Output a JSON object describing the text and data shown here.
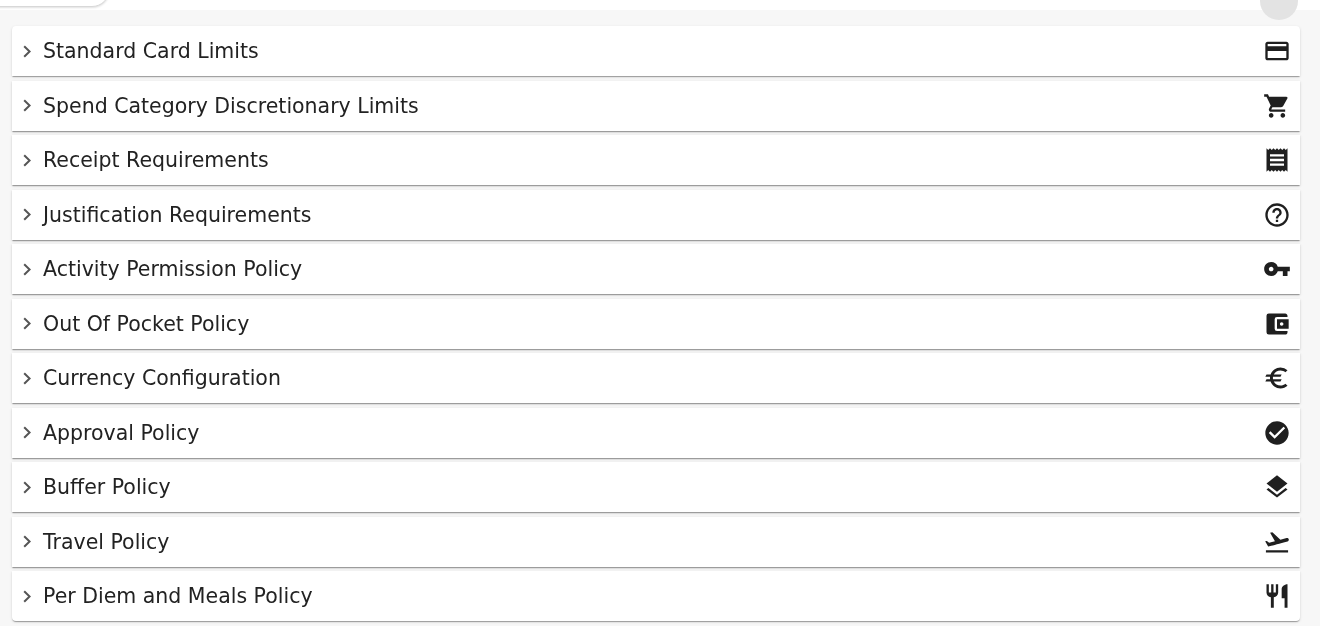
{
  "sections": [
    {
      "title": "Standard Card Limits",
      "kind": "card",
      "expanded": false
    },
    {
      "title": "Spend Category Discretionary Limits",
      "kind": "cart",
      "expanded": false
    },
    {
      "title": "Receipt Requirements",
      "kind": "receipt",
      "expanded": false
    },
    {
      "title": "Justification Requirements",
      "kind": "question",
      "expanded": false
    },
    {
      "title": "Activity Permission Policy",
      "kind": "key",
      "expanded": false
    },
    {
      "title": "Out Of Pocket Policy",
      "kind": "wallet",
      "expanded": false
    },
    {
      "title": "Currency Configuration",
      "kind": "euro",
      "expanded": false
    },
    {
      "title": "Approval Policy",
      "kind": "check",
      "expanded": false
    },
    {
      "title": "Buffer Policy",
      "kind": "layers",
      "expanded": false
    },
    {
      "title": "Travel Policy",
      "kind": "takeoff",
      "expanded": false
    },
    {
      "title": "Per Diem and Meals Policy",
      "kind": "cutlery",
      "expanded": false
    }
  ]
}
